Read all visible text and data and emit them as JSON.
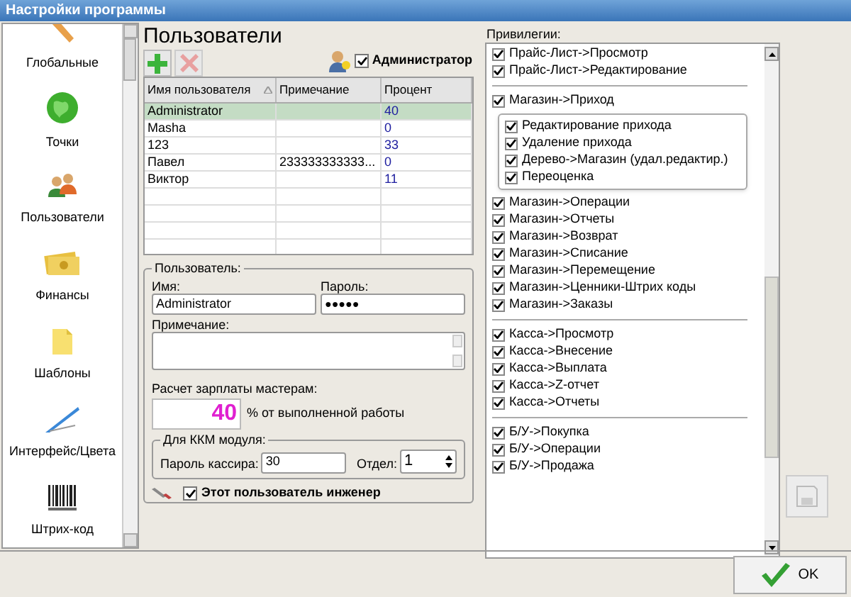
{
  "window": {
    "title": "Настройки программы"
  },
  "sidebar": {
    "items": [
      {
        "label": "Глобальные"
      },
      {
        "label": "Точки"
      },
      {
        "label": "Пользователи"
      },
      {
        "label": "Финансы"
      },
      {
        "label": "Шаблоны"
      },
      {
        "label": "Интерфейс/Цвета"
      },
      {
        "label": "Штрих-код"
      }
    ]
  },
  "users": {
    "title": "Пользователи",
    "admin_checkbox": {
      "label": "Администратор",
      "checked": true
    },
    "table": {
      "columns": [
        "Имя пользователя",
        "Примечание",
        "Процент"
      ],
      "rows": [
        {
          "cells": [
            "Administrator",
            "",
            "40"
          ],
          "selected": true
        },
        {
          "cells": [
            "Masha",
            "",
            "0"
          ],
          "selected": false
        },
        {
          "cells": [
            "123",
            "",
            "33"
          ],
          "selected": false
        },
        {
          "cells": [
            "Павел",
            "233333333333...",
            "0"
          ],
          "selected": false
        },
        {
          "cells": [
            "Виктор",
            "",
            "11"
          ],
          "selected": false
        }
      ]
    }
  },
  "user_form": {
    "legend": "Пользователь:",
    "name_label": "Имя:",
    "name_value": "Administrator",
    "password_label": "Пароль:",
    "password_value": "●●●●●",
    "note_label": "Примечание:",
    "salary_label": "Расчет зарплаты мастерам:",
    "salary_value": "40",
    "salary_suffix": "% от выполненной работы",
    "kkm": {
      "legend": "Для ККМ модуля:",
      "cashier_password_label": "Пароль кассира:",
      "cashier_password_value": "30",
      "department_label": "Отдел:",
      "department_value": "1"
    },
    "engineer_checkbox": {
      "label": "Этот пользователь инженер",
      "checked": true
    }
  },
  "privileges": {
    "label": "Привилегии:",
    "sections": [
      {
        "items": [
          {
            "label": "Прайс-Лист->Просмотр",
            "checked": true
          },
          {
            "label": "Прайс-Лист->Редактирование",
            "checked": true
          }
        ]
      },
      {
        "items": [
          {
            "label": "Магазин->Приход",
            "checked": true,
            "children": [
              {
                "label": "Редактирование прихода",
                "checked": true
              },
              {
                "label": "Удаление прихода",
                "checked": true
              },
              {
                "label": "Дерево->Магазин (удал.редактир.)",
                "checked": true
              },
              {
                "label": "Переоценка",
                "checked": true
              }
            ]
          },
          {
            "label": "Магазин->Операции",
            "checked": true
          },
          {
            "label": "Магазин->Отчеты",
            "checked": true
          },
          {
            "label": "Магазин->Возврат",
            "checked": true
          },
          {
            "label": "Магазин->Списание",
            "checked": true
          },
          {
            "label": "Магазин->Перемещение",
            "checked": true
          },
          {
            "label": "Магазин->Ценники-Штрих коды",
            "checked": true
          },
          {
            "label": "Магазин->Заказы",
            "checked": true
          }
        ]
      },
      {
        "items": [
          {
            "label": "Касса->Просмотр",
            "checked": true
          },
          {
            "label": "Касса->Внесение",
            "checked": true
          },
          {
            "label": "Касса->Выплата",
            "checked": true
          },
          {
            "label": "Касса->Z-отчет",
            "checked": true
          },
          {
            "label": "Касса->Отчеты",
            "checked": true
          }
        ]
      },
      {
        "items": [
          {
            "label": "Б/У->Покупка",
            "checked": true
          },
          {
            "label": "Б/У->Операции",
            "checked": true
          },
          {
            "label": "Б/У->Продажа",
            "checked": true
          }
        ]
      }
    ]
  },
  "ok_button": {
    "label": "OK"
  }
}
